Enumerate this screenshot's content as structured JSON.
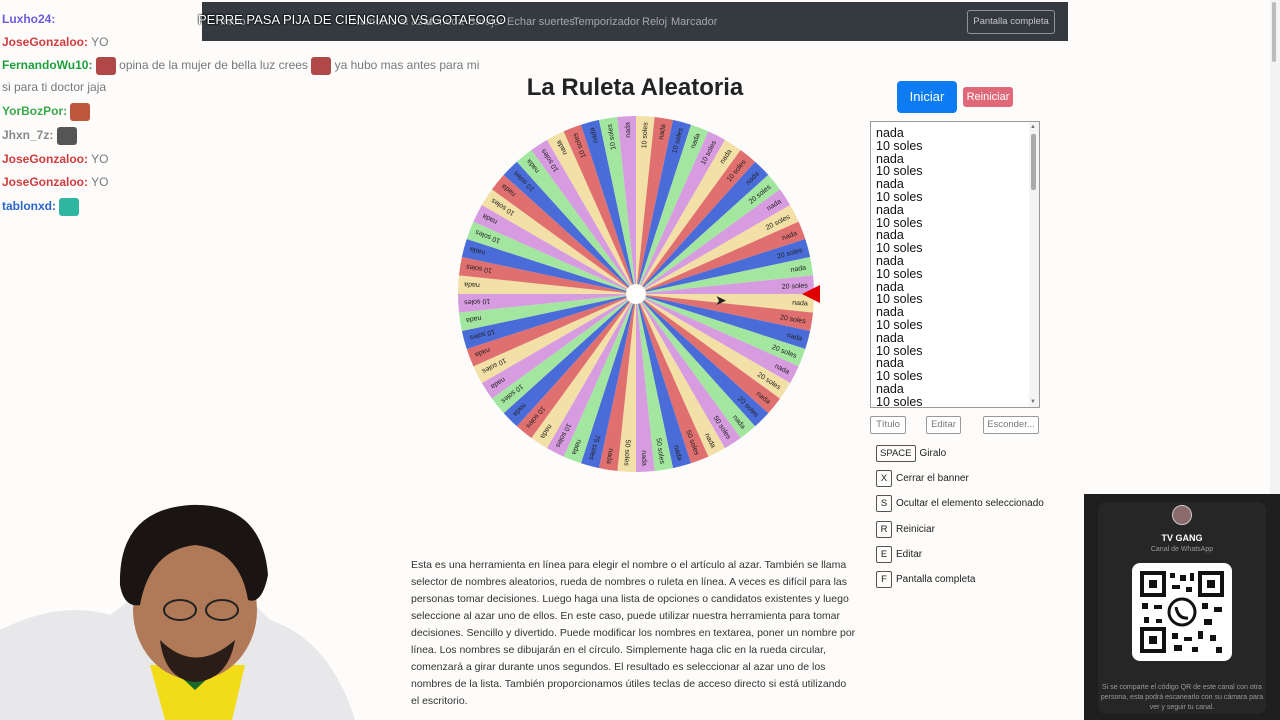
{
  "stream_title": "PERRE PASA PIJA DE CIENCIANO VS GOTAFOGO",
  "nav": {
    "links": [
      "Inicio",
      "Números al azar",
      "Moneda",
      "Barajar",
      "Echar suertes",
      "Temporizador",
      "Reloj",
      "Marcador"
    ],
    "fullscreen_label": "Pantalla completa"
  },
  "chat": [
    {
      "user": "Luxho24:",
      "color": "#6b5bd8",
      "msg": "PERRE PASA PIJA DE CIENCIANO VS GOTAFOGO"
    },
    {
      "user": "JoseGonzaloo:",
      "color": "#d13b3b",
      "msg": "YO"
    },
    {
      "user": "FernandoWu10:",
      "color": "#1e9e3a",
      "msg": "opina de la mujer de bella luz crees",
      "msg2": "ya hubo mas antes para mi"
    },
    {
      "user": "",
      "color": "#777",
      "msg": "si para ti doctor jaja"
    },
    {
      "user": "YorBozPor:",
      "color": "#3aa84a",
      "msg": ""
    },
    {
      "user": "Jhxn_7z:",
      "color": "#888888",
      "msg": ""
    },
    {
      "user": "JoseGonzaloo:",
      "color": "#d13b3b",
      "msg": "YO"
    },
    {
      "user": "JoseGonzaloo:",
      "color": "#d13b3b",
      "msg": "YO"
    },
    {
      "user": "tablonxd:",
      "color": "#2a64c8",
      "msg": ""
    }
  ],
  "main": {
    "title": "La Ruleta Aleatoria",
    "start_label": "Iniciar",
    "reset_label": "Reiniciar",
    "entries": [
      "nada",
      "10 soles",
      "nada",
      "10 soles",
      "nada",
      "10 soles",
      "nada",
      "10 soles",
      "nada",
      "10 soles",
      "nada",
      "10 soles",
      "nada",
      "10 soles",
      "nada",
      "10 soles",
      "nada",
      "10 soles",
      "nada",
      "10 soles",
      "nada",
      "10 soles"
    ],
    "title_btn": "Título",
    "edit_btn": "Editar",
    "hide_btn": "Esconder..."
  },
  "wheel": {
    "labels": [
      "nada",
      "20 soles",
      "nada",
      "20 soles",
      "nada",
      "20 soles",
      "nada",
      "20 soles",
      "nada",
      "50 soles",
      "nada",
      "50 soles",
      "nada",
      "50 soles",
      "nada",
      "50 soles",
      "nada",
      "75 soles",
      "nada",
      "10 soles",
      "nada",
      "10 soles",
      "nada",
      "10 soles",
      "nada",
      "10 soles",
      "nada",
      "10 soles",
      "nada",
      "10 soles",
      "nada",
      "10 soles",
      "nada",
      "10 soles",
      "nada",
      "10 soles",
      "nada",
      "10 soles",
      "nada",
      "10 soles",
      "nada",
      "10 soles",
      "nada",
      "10 soles",
      "nada",
      "10 soles",
      "nada",
      "10 soles",
      "nada",
      "10 soles",
      "nada",
      "10 soles",
      "nada",
      "20 soles",
      "nada",
      "20 soles",
      "nada",
      "20 soles",
      "nada",
      "20 soles"
    ],
    "colors": [
      "#f2e0a6",
      "#e07070",
      "#4a6cd8",
      "#a3e6a0",
      "#d79be0"
    ]
  },
  "shortcuts": [
    {
      "key": "SPACE",
      "label": "Giralo"
    },
    {
      "key": "X",
      "label": "Cerrar el banner"
    },
    {
      "key": "S",
      "label": "Ocultar el elemento seleccionado"
    },
    {
      "key": "R",
      "label": "Reiniciar"
    },
    {
      "key": "E",
      "label": "Editar"
    },
    {
      "key": "F",
      "label": "Pantalla completa"
    }
  ],
  "description": "Esta es una herramienta en línea para elegir el nombre o el artículo al azar. También se llama selector de nombres aleatorios, rueda de nombres o ruleta en línea. A veces es difícil para las personas tomar decisiones. Luego haga una lista de opciones o candidatos existentes y luego seleccione al azar uno de ellos. En este caso, puede utilizar nuestra herramienta para tomar decisiones. Sencillo y divertido. Puede modificar los nombres en textarea, poner un nombre por línea. Los nombres se dibujarán en el círculo. Simplemente haga clic en la rueda circular, comenzará a girar durante unos segundos. El resultado es seleccionar al azar uno de los nombres de la lista. También proporcionamos útiles teclas de acceso directo si está utilizando el escritorio.",
  "whatsapp": {
    "name": "TV GANG",
    "subtitle": "Canal de WhatsApp",
    "footer": "Si se comparte el código QR de este canal con otra persona, esta podrá escanearlo con su cámara para ver y seguir tu canal."
  }
}
